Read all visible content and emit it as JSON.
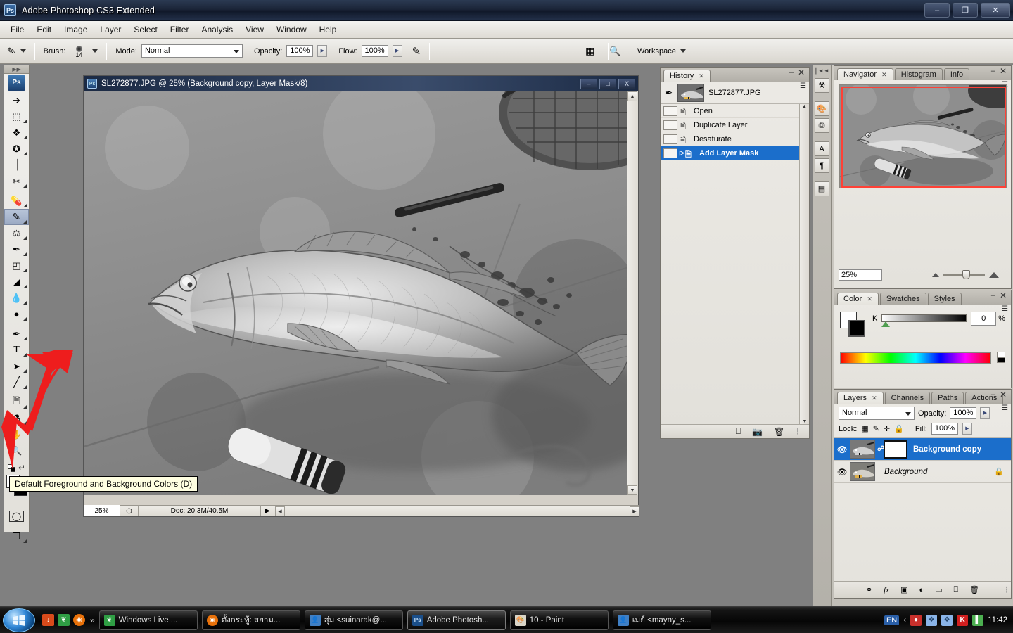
{
  "app": {
    "title": "Adobe Photoshop CS3 Extended",
    "icon": "photoshop-icon",
    "logo_text": "Ps"
  },
  "window_controls": {
    "minimize": "–",
    "restore": "❐",
    "close": "✕"
  },
  "menubar": {
    "items": [
      "File",
      "Edit",
      "Image",
      "Layer",
      "Select",
      "Filter",
      "Analysis",
      "View",
      "Window",
      "Help"
    ]
  },
  "options_bar": {
    "tool_icon": "brush-tool-icon",
    "brush_label": "Brush:",
    "brush_size": "14",
    "mode_label": "Mode:",
    "mode_value": "Normal",
    "opacity_label": "Opacity:",
    "opacity_value": "100%",
    "flow_label": "Flow:",
    "flow_value": "100%",
    "airbrush_icon": "airbrush-icon",
    "palettes_icon": "palettes-toggle-icon",
    "bridge_icon": "go-to-bridge-icon",
    "workspace_label": "Workspace"
  },
  "toolbox": {
    "logo": "Ps",
    "tools": [
      {
        "name": "move-tool",
        "glyph": "↖"
      },
      {
        "name": "rectangular-marquee-tool",
        "glyph": "⬚"
      },
      {
        "name": "lasso-tool",
        "glyph": "❦"
      },
      {
        "name": "magic-wand-tool",
        "glyph": "✦"
      },
      {
        "name": "crop-tool",
        "glyph": "⌗"
      },
      {
        "name": "slice-tool",
        "glyph": "✂"
      },
      {
        "name": "healing-brush-tool",
        "glyph": "✐"
      },
      {
        "name": "brush-tool",
        "glyph": "✎",
        "selected": true
      },
      {
        "name": "clone-stamp-tool",
        "glyph": "⚲"
      },
      {
        "name": "history-brush-tool",
        "glyph": "✒"
      },
      {
        "name": "eraser-tool",
        "glyph": "◰"
      },
      {
        "name": "gradient-paint-bucket-tool",
        "glyph": "◢"
      },
      {
        "name": "blur-tool",
        "glyph": "●"
      },
      {
        "name": "dodge-tool",
        "glyph": "◔"
      },
      {
        "name": "pen-tool",
        "glyph": "✒"
      },
      {
        "name": "horizontal-type-tool",
        "glyph": "T"
      },
      {
        "name": "path-selection-tool",
        "glyph": "▶"
      },
      {
        "name": "line-shape-tool",
        "glyph": "╱"
      },
      {
        "name": "notes-tool",
        "glyph": "☰"
      },
      {
        "name": "eyedropper-tool",
        "glyph": "⚗"
      },
      {
        "name": "hand-tool",
        "glyph": "✋"
      },
      {
        "name": "zoom-tool",
        "glyph": "⚲"
      }
    ],
    "default-colors-icon": "default-foreground-background-colors-icon",
    "swap-colors-icon": "swap-foreground-background-colors-icon",
    "quickmask-icon": "quick-mask-mode-icon",
    "screenmode-icon": "screen-mode-icon",
    "foreground_color": "#ffffff",
    "background_color": "#000000"
  },
  "tooltip": {
    "text": "Default Foreground and Background Colors (D)"
  },
  "document": {
    "title": "SL272877.JPG @ 25% (Background copy, Layer Mask/8)",
    "window_buttons": {
      "minimize": "–",
      "maximize": "□",
      "close": "X"
    },
    "zoom": "25%",
    "doc_size": "Doc: 20.3M/40.5M",
    "filename": "SL272877.JPG"
  },
  "history_panel": {
    "tabs": [
      {
        "label": "History",
        "active": true
      }
    ],
    "snapshot": {
      "label": "SL272877.JPG",
      "icon": "history-brush-source-icon"
    },
    "states": [
      {
        "label": "Open",
        "selected": false
      },
      {
        "label": "Duplicate Layer",
        "selected": false
      },
      {
        "label": "Desaturate",
        "selected": false
      },
      {
        "label": "Add Layer Mask",
        "selected": true
      }
    ],
    "buttons": [
      {
        "name": "create-document-from-state-button",
        "glyph": "⧉"
      },
      {
        "name": "create-new-snapshot-button",
        "glyph": "⬜"
      },
      {
        "name": "delete-state-button",
        "glyph": "♻"
      }
    ]
  },
  "dock_strip": {
    "collapse_icon": "collapse-dock-icon",
    "buttons": [
      {
        "name": "tool-presets-icon",
        "glyph": "⚒"
      },
      {
        "name": "brushes-panel-icon",
        "glyph": "✂"
      },
      {
        "name": "clone-source-panel-icon",
        "glyph": "⎙"
      },
      {
        "name": "character-panel-icon",
        "glyph": "A"
      },
      {
        "name": "paragraph-panel-icon",
        "glyph": "¶"
      },
      {
        "name": "layer-comps-panel-icon",
        "glyph": "▤"
      }
    ]
  },
  "navigator_panel": {
    "tabs": [
      {
        "label": "Navigator",
        "active": true
      },
      {
        "label": "Histogram",
        "active": false
      },
      {
        "label": "Info",
        "active": false
      }
    ],
    "zoom_value": "25%",
    "zoom_out_icon": "zoom-out-icon",
    "zoom_in_icon": "zoom-in-icon",
    "view_box_color": "#ff4136"
  },
  "color_panel": {
    "tabs": [
      {
        "label": "Color",
        "active": true
      },
      {
        "label": "Swatches",
        "active": false
      },
      {
        "label": "Styles",
        "active": false
      }
    ],
    "channel_label": "K",
    "channel_value": "0",
    "percent_symbol": "%",
    "foreground": "#ffffff",
    "background": "#000000"
  },
  "layers_panel": {
    "tabs": [
      {
        "label": "Layers",
        "active": true
      },
      {
        "label": "Channels",
        "active": false
      },
      {
        "label": "Paths",
        "active": false
      },
      {
        "label": "Actions",
        "active": false
      }
    ],
    "blend_mode": "Normal",
    "opacity_label": "Opacity:",
    "opacity_value": "100%",
    "lock_label": "Lock:",
    "fill_label": "Fill:",
    "fill_value": "100%",
    "lock_icons": [
      {
        "name": "lock-transparent-pixels-icon",
        "glyph": "▦"
      },
      {
        "name": "lock-image-pixels-icon",
        "glyph": "✎"
      },
      {
        "name": "lock-position-icon",
        "glyph": "✛"
      },
      {
        "name": "lock-all-icon",
        "glyph": "🔒"
      }
    ],
    "layers": [
      {
        "name": "Background copy",
        "selected": true,
        "visible": true,
        "has_mask": true,
        "locked": false,
        "italic": false
      },
      {
        "name": "Background",
        "selected": false,
        "visible": true,
        "has_mask": false,
        "locked": true,
        "italic": true
      }
    ],
    "buttons": [
      {
        "name": "link-layers-button",
        "glyph": "⚭"
      },
      {
        "name": "layer-style-button",
        "glyph": "ƒx"
      },
      {
        "name": "add-layer-mask-button",
        "glyph": "▣"
      },
      {
        "name": "new-adjustment-layer-button",
        "glyph": "◐"
      },
      {
        "name": "new-group-button",
        "glyph": "▱"
      },
      {
        "name": "new-layer-button",
        "glyph": "⧉"
      },
      {
        "name": "delete-layer-button",
        "glyph": "♻"
      }
    ]
  },
  "taskbar": {
    "start_button": "start-button",
    "quick_launch": [
      {
        "name": "download-manager-icon",
        "glyph": "↓",
        "color": "#d84a1b"
      },
      {
        "name": "windows-live-messenger-icon",
        "glyph": "❦",
        "color": "#2f9e44"
      },
      {
        "name": "firefox-icon",
        "glyph": "◉",
        "color": "#e8710a"
      }
    ],
    "quick_launch_overflow": "»",
    "items": [
      {
        "label": "Windows Live ...",
        "icon": "messenger-icon",
        "active": false
      },
      {
        "label": "ตั้งกระทู้: สยาม...",
        "icon": "firefox-icon",
        "active": false
      },
      {
        "label": "สุ่ม <suinarak@...",
        "icon": "contact-icon",
        "active": false
      },
      {
        "label": "Adobe Photosh...",
        "icon": "photoshop-icon",
        "active": true
      },
      {
        "label": "10 - Paint",
        "icon": "paint-icon",
        "active": false
      },
      {
        "label": "เมย์ <mayny_s...",
        "icon": "contact-icon",
        "active": false
      }
    ],
    "tray": {
      "language": "EN",
      "expand": "‹",
      "icons": [
        {
          "name": "shield-security-icon",
          "glyph": "●",
          "color": "#c9302c"
        },
        {
          "name": "network-icon",
          "glyph": "❖",
          "color": "#8ab4e8"
        },
        {
          "name": "network-2-icon",
          "glyph": "❖",
          "color": "#8ab4e8"
        },
        {
          "name": "kaspersky-icon",
          "glyph": "K",
          "color": "#d11f1f"
        },
        {
          "name": "battery-icon",
          "glyph": "▌",
          "color": "#4caf50"
        }
      ],
      "clock": "11:42"
    }
  }
}
